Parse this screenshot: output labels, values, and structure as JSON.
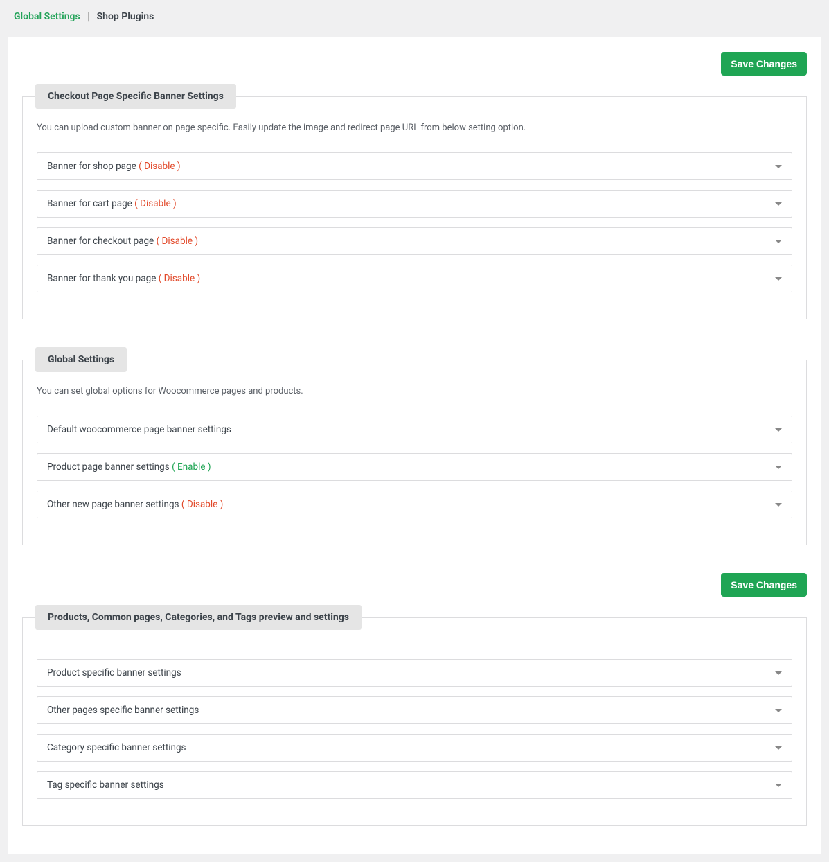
{
  "tabs": {
    "global": "Global Settings",
    "shop": "Shop Plugins"
  },
  "buttons": {
    "save": "Save Changes"
  },
  "status": {
    "disable": "( Disable )",
    "enable": "( Enable )"
  },
  "sections": {
    "checkout": {
      "title": "Checkout Page Specific Banner Settings",
      "desc": "You can upload custom banner on page specific. Easily update the image and redirect page URL from below setting option.",
      "items": [
        {
          "label": "Banner for shop page ",
          "status": "disable"
        },
        {
          "label": "Banner for cart page ",
          "status": "disable"
        },
        {
          "label": "Banner for checkout page ",
          "status": "disable"
        },
        {
          "label": "Banner for thank you page ",
          "status": "disable"
        }
      ]
    },
    "global": {
      "title": "Global Settings",
      "desc": "You can set global options for Woocommerce pages and products.",
      "items": [
        {
          "label": "Default woocommerce page banner settings",
          "status": ""
        },
        {
          "label": "Product page banner settings ",
          "status": "enable"
        },
        {
          "label": "Other new page banner settings ",
          "status": "disable"
        }
      ]
    },
    "products": {
      "title": "Products, Common pages, Categories, and Tags preview and settings",
      "desc": "",
      "items": [
        {
          "label": "Product specific banner settings",
          "status": ""
        },
        {
          "label": "Other pages specific banner settings",
          "status": ""
        },
        {
          "label": "Category specific banner settings",
          "status": ""
        },
        {
          "label": "Tag specific banner settings",
          "status": ""
        }
      ]
    }
  }
}
